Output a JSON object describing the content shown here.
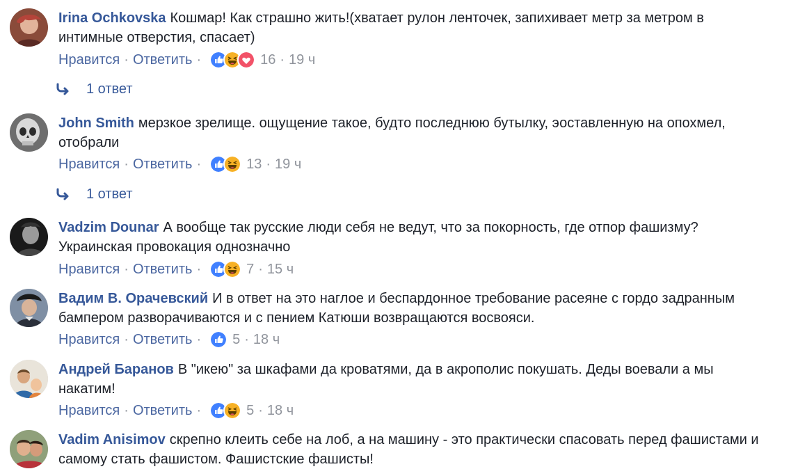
{
  "comments": [
    {
      "author": "Irina Ochkovska",
      "text": "Кошмар! Как страшно жить!(хватает рулон ленточек, запихивает метр за метром в интимные отверстия, спасает)",
      "like_label": "Нравится",
      "reply_label": "Ответить",
      "reactions": [
        "like-icon",
        "haha-icon",
        "love-icon"
      ],
      "reaction_count": "16",
      "time": "19 ч",
      "replies_label": "1 ответ"
    },
    {
      "author": "John Smith",
      "text": "мерзкое зрелище. ощущение такое, будто последнюю бутылку, эоставленную на опохмел, отобрали",
      "like_label": "Нравится",
      "reply_label": "Ответить",
      "reactions": [
        "like-icon",
        "haha-icon"
      ],
      "reaction_count": "13",
      "time": "19 ч",
      "replies_label": "1 ответ"
    },
    {
      "author": "Vadzim Dounar",
      "text": "А вообще так русские люди себя не ведут, что за покорность, где отпор фашизму? Украинская провокация однозначно",
      "like_label": "Нравится",
      "reply_label": "Ответить",
      "reactions": [
        "like-icon",
        "haha-icon"
      ],
      "reaction_count": "7",
      "time": "15 ч"
    },
    {
      "author": "Вадим В. Орачевский",
      "text": "И в ответ на это наглое и беспардонное требование расеяне с гордо задранным бампером разворачиваются и с пением Катюши возвращаются восвояси.",
      "like_label": "Нравится",
      "reply_label": "Ответить",
      "reactions": [
        "like-icon"
      ],
      "reaction_count": "5",
      "time": "18 ч"
    },
    {
      "author": "Андрей Баранов",
      "text": "В \"икею\" за шкафами да кроватями, да в акрополис покушать. Деды воевали а мы накатим!",
      "like_label": "Нравится",
      "reply_label": "Ответить",
      "reactions": [
        "like-icon",
        "haha-icon"
      ],
      "reaction_count": "5",
      "time": "18 ч"
    },
    {
      "author": "Vadim Anisimov",
      "text": "скрепно клеить себе на лоб, а на машину - это практически спасовать перед фашистами и самому стать фашистом. Фашистские фашисты!"
    }
  ],
  "colors": {
    "author": "#365899",
    "link": "#4b67a1",
    "meta": "#90949c",
    "like": "#4080ff",
    "haha": "#f7b125",
    "love": "#f25268"
  }
}
